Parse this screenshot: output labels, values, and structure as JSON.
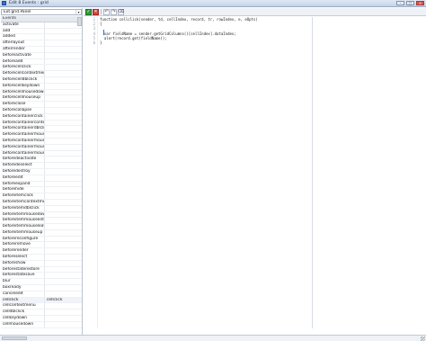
{
  "window": {
    "title": "Edit 8 Events : grid"
  },
  "titlebar_buttons": [
    {
      "name": "minimize",
      "label": "–"
    },
    {
      "name": "maximize",
      "label": "□"
    },
    {
      "name": "close",
      "label": "×"
    }
  ],
  "selector": {
    "value": "Ext.grid.Panel",
    "arrow": "▾"
  },
  "events": {
    "header": "Events",
    "items": [
      {
        "name": "activate",
        "value": ""
      },
      {
        "name": "add",
        "value": ""
      },
      {
        "name": "added",
        "value": ""
      },
      {
        "name": "afterlayout",
        "value": ""
      },
      {
        "name": "afterrender",
        "value": ""
      },
      {
        "name": "beforeactivate",
        "value": ""
      },
      {
        "name": "beforeadd",
        "value": ""
      },
      {
        "name": "beforecellclick",
        "value": ""
      },
      {
        "name": "beforecellcontextmenu",
        "value": ""
      },
      {
        "name": "beforecelldblclick",
        "value": ""
      },
      {
        "name": "beforecellkeydown",
        "value": ""
      },
      {
        "name": "beforecellmousedown",
        "value": ""
      },
      {
        "name": "beforecellmouseup",
        "value": ""
      },
      {
        "name": "beforeclose",
        "value": ""
      },
      {
        "name": "beforecollapse",
        "value": ""
      },
      {
        "name": "beforecontainerclick",
        "value": ""
      },
      {
        "name": "beforecontainercontextmenu",
        "value": ""
      },
      {
        "name": "beforecontainerdblclick",
        "value": ""
      },
      {
        "name": "beforecontainermousedown",
        "value": ""
      },
      {
        "name": "beforecontainermouseout",
        "value": ""
      },
      {
        "name": "beforecontainermouseover",
        "value": ""
      },
      {
        "name": "beforecontainermouseup",
        "value": ""
      },
      {
        "name": "beforedeactivate",
        "value": ""
      },
      {
        "name": "beforedeselect",
        "value": ""
      },
      {
        "name": "beforedestroy",
        "value": ""
      },
      {
        "name": "beforeedit",
        "value": ""
      },
      {
        "name": "beforeexpand",
        "value": ""
      },
      {
        "name": "beforehide",
        "value": ""
      },
      {
        "name": "beforeitemclick",
        "value": ""
      },
      {
        "name": "beforeitemcontextmenu",
        "value": ""
      },
      {
        "name": "beforeitemdblclick",
        "value": ""
      },
      {
        "name": "beforeitemmousedown",
        "value": ""
      },
      {
        "name": "beforeitemmouseenter",
        "value": ""
      },
      {
        "name": "beforeitemmouseleave",
        "value": ""
      },
      {
        "name": "beforeitemmouseup",
        "value": ""
      },
      {
        "name": "beforereconfigure",
        "value": ""
      },
      {
        "name": "beforeremove",
        "value": ""
      },
      {
        "name": "beforerender",
        "value": ""
      },
      {
        "name": "beforeselect",
        "value": ""
      },
      {
        "name": "beforeshow",
        "value": ""
      },
      {
        "name": "beforestaterestore",
        "value": ""
      },
      {
        "name": "beforestatesave",
        "value": ""
      },
      {
        "name": "blur",
        "value": ""
      },
      {
        "name": "boxready",
        "value": ""
      },
      {
        "name": "canceledit",
        "value": ""
      },
      {
        "name": "cellclick",
        "value": "cellclick"
      },
      {
        "name": "cellcontextmenu",
        "value": ""
      },
      {
        "name": "celldblclick",
        "value": ""
      },
      {
        "name": "cellkeydown",
        "value": ""
      },
      {
        "name": "cellmousedown",
        "value": ""
      }
    ]
  },
  "toolbar": {
    "buttons": [
      {
        "name": "save",
        "glyph": "✓",
        "style": "ok"
      },
      {
        "name": "cancel",
        "glyph": "✕",
        "style": "cancel"
      },
      {
        "name": "undo",
        "glyph": "↶",
        "style": "plain"
      },
      {
        "name": "redo",
        "glyph": "↷",
        "style": "plain"
      },
      {
        "name": "clear",
        "glyph": "⌫",
        "style": "plain"
      }
    ]
  },
  "code": {
    "lines": [
      "function cellclick(sender, td, cellIndex, record, tr, rowIndex, e, eOpts)",
      "{",
      "",
      "  var fieldName = sender.getGridColumns()[cellIndex].dataIndex;",
      "  alert(record.get(fieldName));",
      "}"
    ],
    "line_numbers": [
      "1",
      "2",
      "3",
      "4",
      "5",
      "6"
    ]
  },
  "colors": {
    "accent": "#3a6fc4",
    "save_green": "#2d9d3a",
    "cancel_red": "#d7413b"
  }
}
